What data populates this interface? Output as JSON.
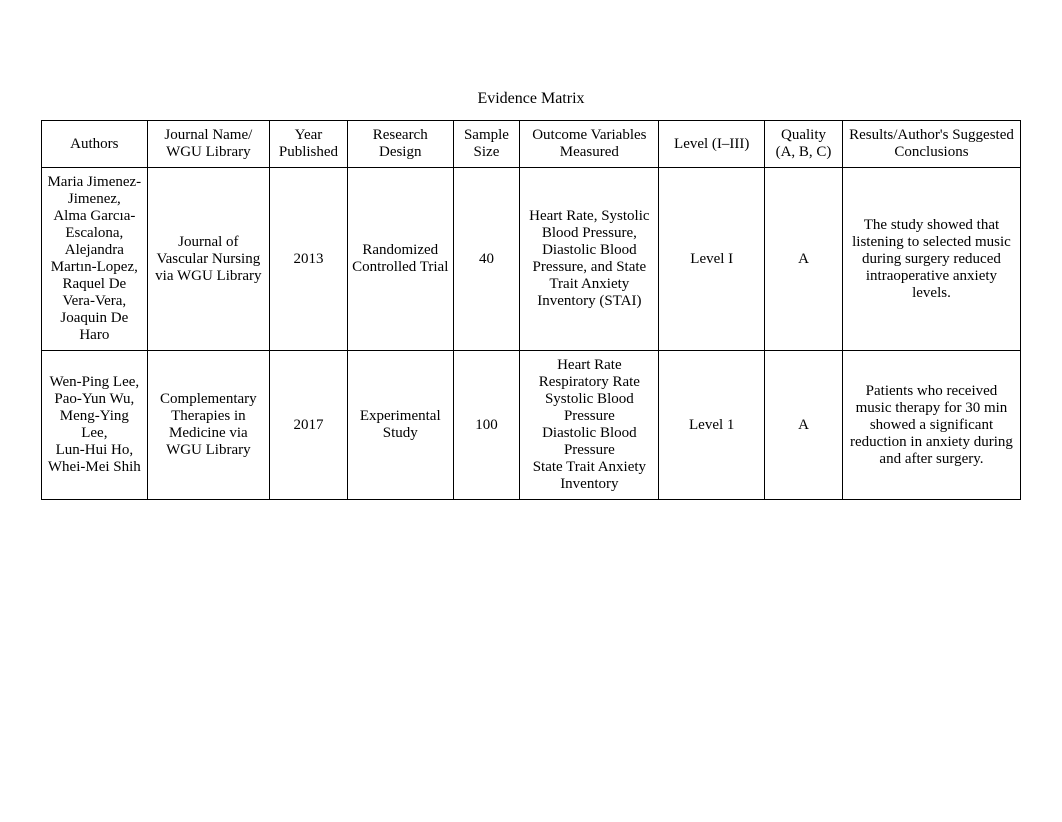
{
  "title": "Evidence Matrix",
  "headers": {
    "authors": "Authors",
    "journal": "Journal Name/\nWGU Library",
    "year": "Year Published",
    "design": "Research Design",
    "sample": "Sample Size",
    "outcome": "Outcome Variables Measured",
    "level": "Level (I–III)",
    "quality": "Quality\n(A, B, C)",
    "results": "Results/Author's Suggested Conclusions"
  },
  "rows": [
    {
      "authors": "Maria Jimenez-Jimenez,\nAlma Garcıa-Escalona,\nAlejandra Martın-Lopez,\nRaquel De Vera-Vera,\nJoaquin De Haro",
      "journal": "Journal of Vascular Nursing via WGU Library",
      "year": "2013",
      "design": "Randomized Controlled Trial",
      "sample": "40",
      "outcome": "Heart Rate, Systolic Blood Pressure, Diastolic Blood Pressure, and State Trait Anxiety Inventory (STAI)",
      "level": "Level I",
      "quality": "A",
      "results": "The study showed that listening to selected music during surgery reduced intraoperative anxiety levels."
    },
    {
      "authors": "Wen-Ping Lee,\nPao-Yun Wu,\nMeng-Ying Lee,\nLun-Hui Ho,\nWhei-Mei Shih",
      "journal": "Complementary Therapies in Medicine via WGU Library",
      "year": "2017",
      "design": "Experimental Study",
      "sample": "100",
      "outcome": "Heart Rate\nRespiratory Rate\nSystolic Blood Pressure\nDiastolic Blood Pressure\nState Trait Anxiety Inventory",
      "level": "Level 1",
      "quality": "A",
      "results": "Patients who received music therapy for 30 min showed a significant reduction in anxiety during and after surgery."
    }
  ]
}
